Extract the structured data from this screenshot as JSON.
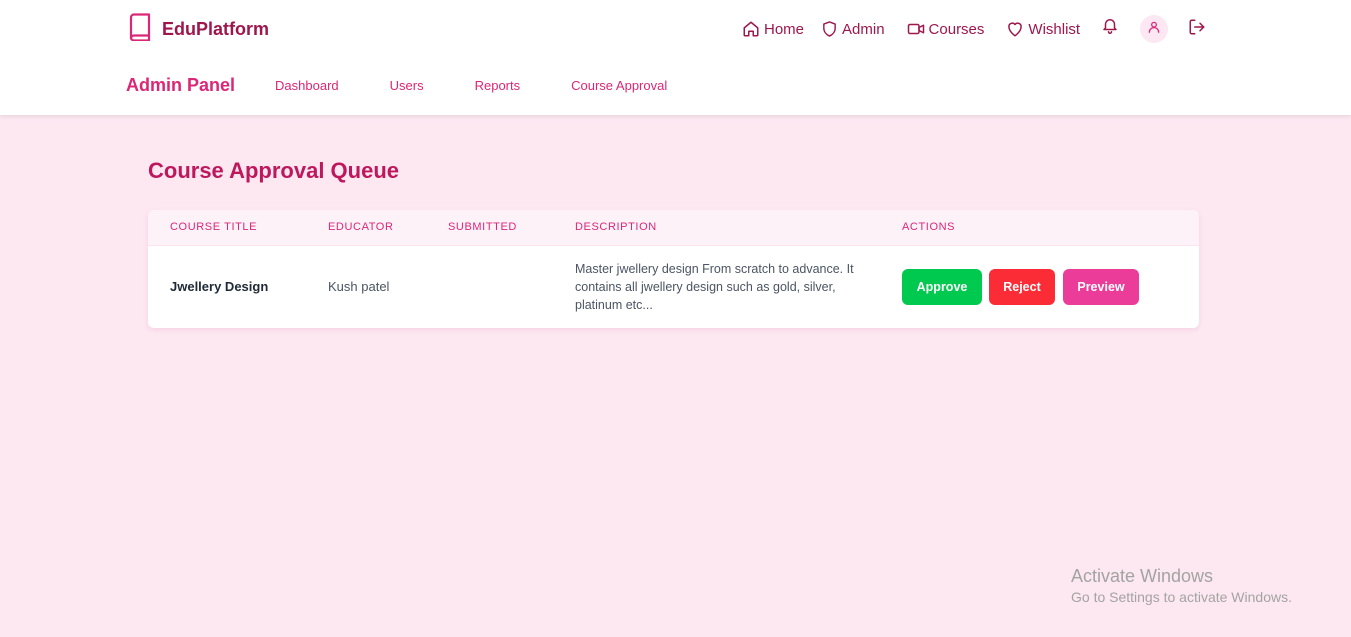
{
  "app": {
    "brand": "EduPlatform",
    "colors": {
      "brand": "#9d174d",
      "accent": "#db2777",
      "heading": "#be185d",
      "background": "#fde8f2",
      "approve": "#00c950",
      "reject": "#fb2c36",
      "preview": "#ec3c9a"
    }
  },
  "topnav": {
    "items": [
      {
        "label": "Home",
        "icon": "home-icon"
      },
      {
        "label": "Admin",
        "icon": "shield-icon"
      },
      {
        "label": "Courses",
        "icon": "video-icon"
      },
      {
        "label": "Wishlist",
        "icon": "heart-icon"
      }
    ],
    "icons": [
      "bell-icon",
      "user-icon",
      "logout-icon"
    ]
  },
  "subnav": {
    "title": "Admin Panel",
    "links": [
      "Dashboard",
      "Users",
      "Reports",
      "Course Approval"
    ]
  },
  "main": {
    "title": "Course Approval Queue",
    "table": {
      "columns": [
        "Course Title",
        "Educator",
        "Submitted",
        "Description",
        "Actions"
      ],
      "rows": [
        {
          "course_title": "Jwellery Design",
          "educator": "Kush patel",
          "submitted": "",
          "description": "Master jwellery design From scratch to advance. It contains all jwellery design such as gold, silver, platinum etc...",
          "actions": [
            "Approve",
            "Reject",
            "Preview"
          ]
        }
      ]
    }
  },
  "watermark": {
    "title": "Activate Windows",
    "subtitle": "Go to Settings to activate Windows."
  }
}
